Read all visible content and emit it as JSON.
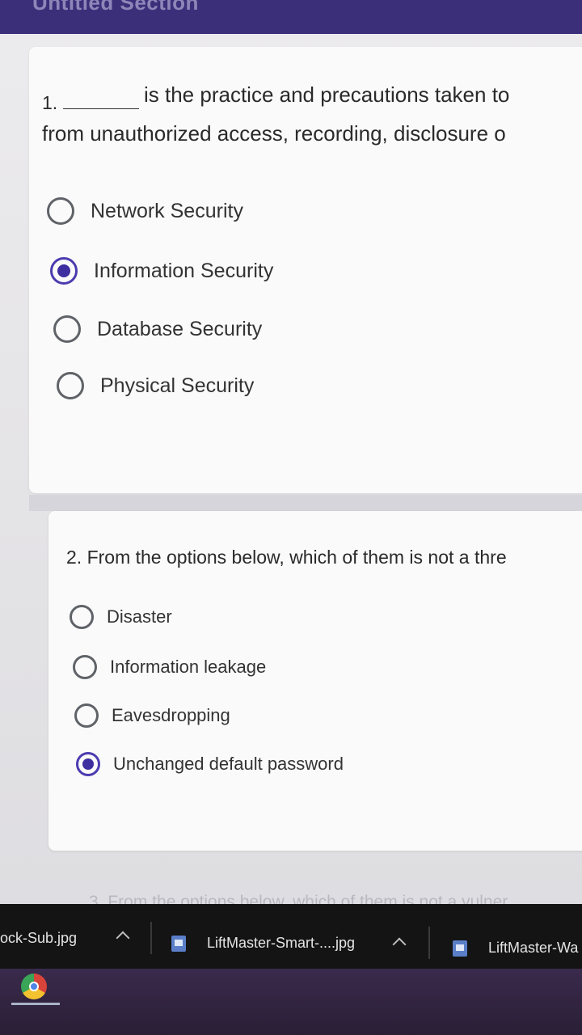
{
  "section": {
    "title": "Untitled Section"
  },
  "question1": {
    "number": "1.",
    "text_line1": "is the practice and precautions taken to",
    "text_line2": "from unauthorized access, recording, disclosure o",
    "options": [
      {
        "label": "Network Security",
        "selected": false
      },
      {
        "label": "Information Security",
        "selected": true
      },
      {
        "label": "Database Security",
        "selected": false
      },
      {
        "label": "Physical Security",
        "selected": false
      }
    ]
  },
  "question2": {
    "text": "2. From the options below, which of them is not a thre",
    "options": [
      {
        "label": "Disaster",
        "selected": false
      },
      {
        "label": "Information leakage",
        "selected": false
      },
      {
        "label": "Eavesdropping",
        "selected": false
      },
      {
        "label": "Unchanged default password",
        "selected": true
      }
    ]
  },
  "question3": {
    "text": "3. From the options below, which of them is not a vulner"
  },
  "taskbar": {
    "downloads": [
      {
        "name": "ock-Sub.jpg"
      },
      {
        "name": "LiftMaster-Smart-....jpg"
      },
      {
        "name": "LiftMaster-Wa"
      }
    ]
  },
  "launcher": {
    "apps": [
      "chrome-icon"
    ]
  },
  "colors": {
    "header": "#3b2f7a",
    "radio_selected": "#3d2fa0",
    "card": "#fafafa",
    "taskbar": "#141414"
  }
}
